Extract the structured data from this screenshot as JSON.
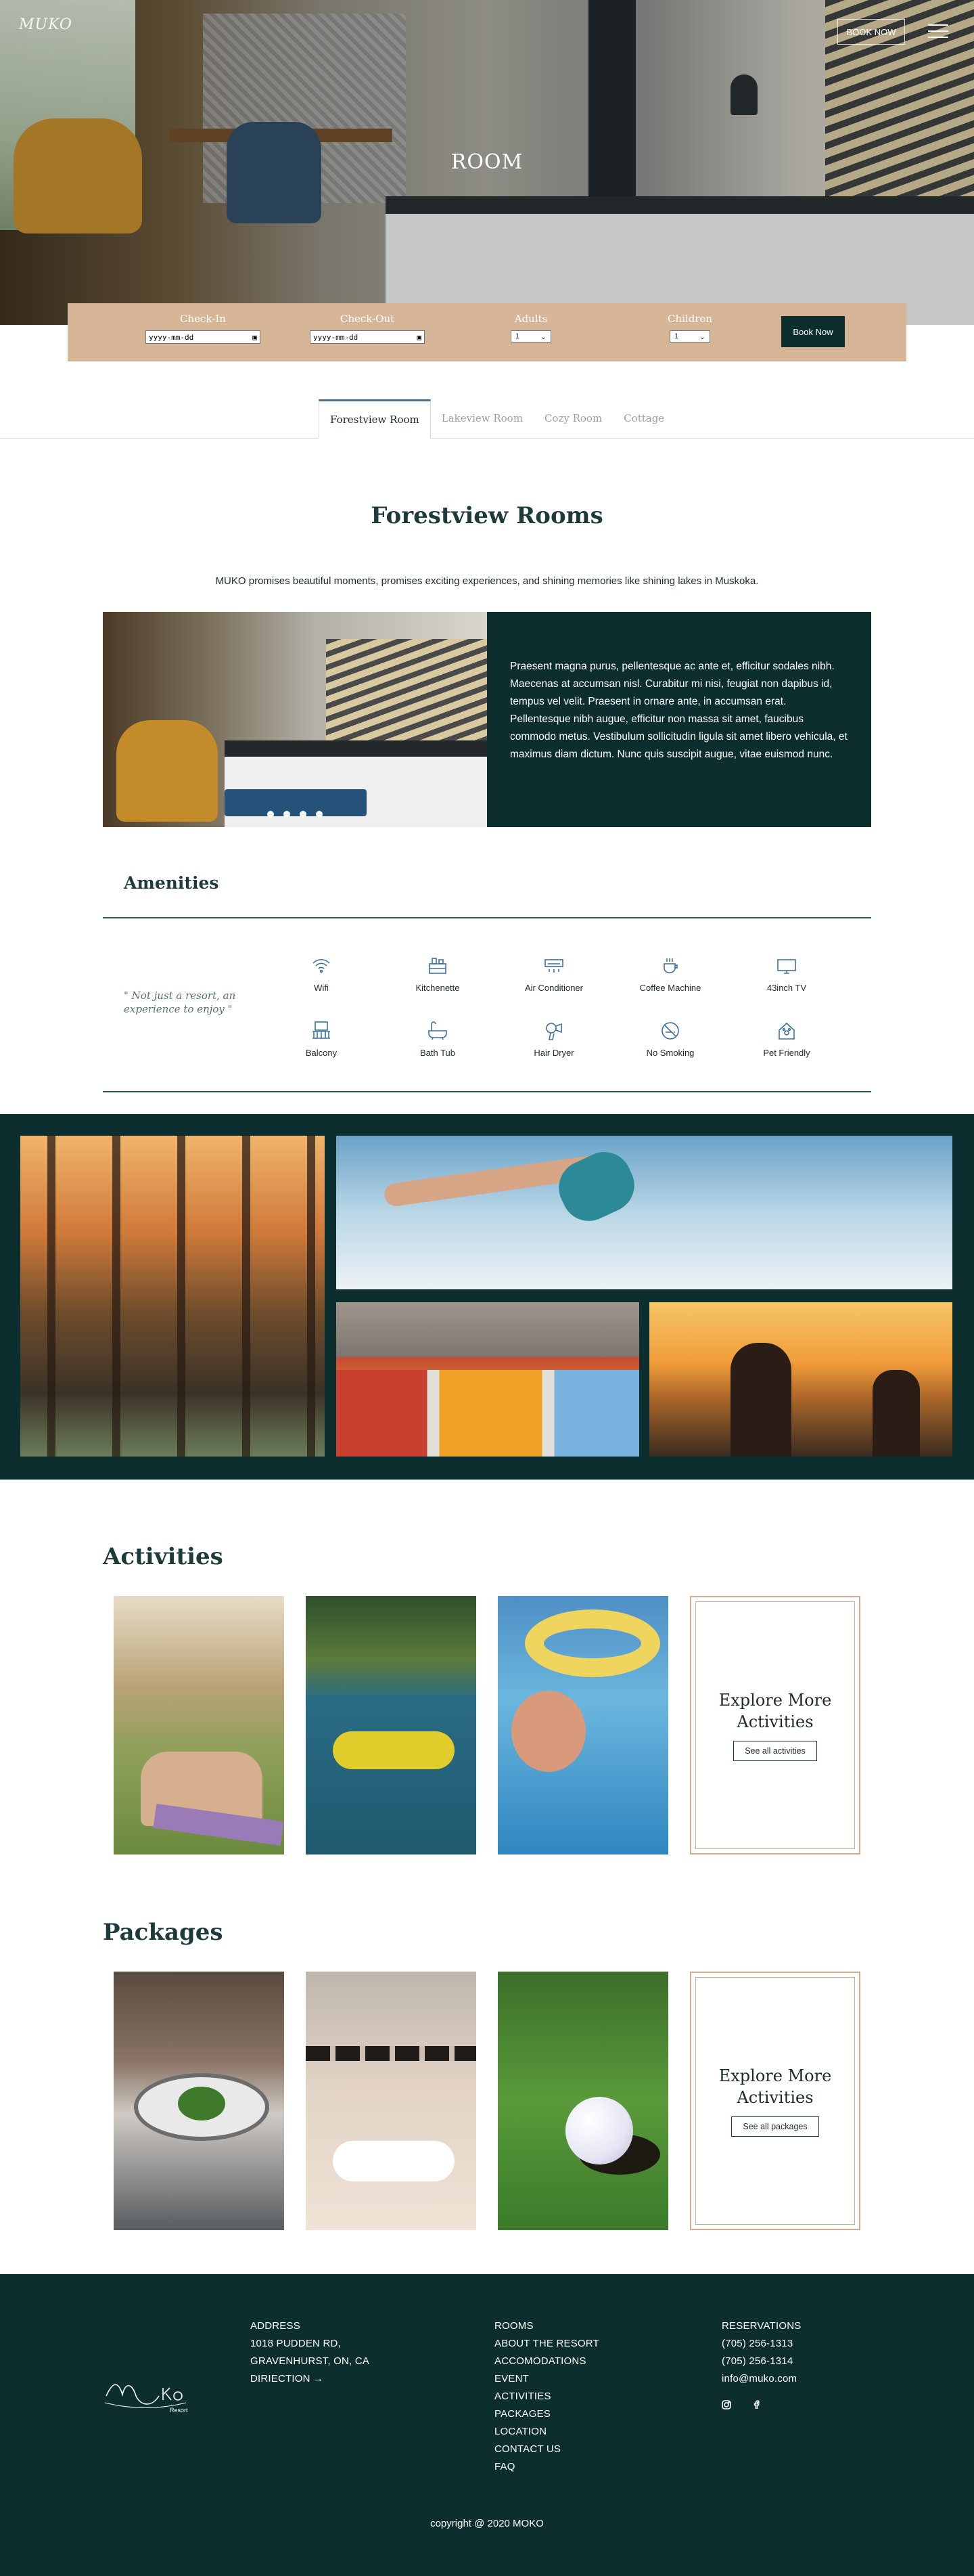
{
  "header": {
    "logo_text": "MUKO",
    "book_now_label": "BOOK NOW",
    "hero_title": "ROOM"
  },
  "booking": {
    "checkin_label": "Check-In",
    "checkin_placeholder": "yyyy-mm-dd",
    "checkout_label": "Check-Out",
    "checkout_placeholder": "yyyy-mm-dd",
    "adults_label": "Adults",
    "adults_value": "1",
    "children_label": "Children",
    "children_value": "1",
    "book_button": "Book Now"
  },
  "tabs": [
    {
      "label": "Forestview Room",
      "active": true
    },
    {
      "label": "Lakeview Room",
      "active": false
    },
    {
      "label": "Cozy Room",
      "active": false
    },
    {
      "label": "Cottage",
      "active": false
    }
  ],
  "room": {
    "title": "Forestview Rooms",
    "intro": "MUKO promises beautiful moments, promises exciting experiences, and shining memories like shining lakes in Muskoka.",
    "description": "Praesent magna purus, pellentesque ac ante et, efficitur sodales nibh. Maecenas at accumsan nisl. Curabitur mi nisi, feugiat non dapibus id, tempus vel velit. Praesent in ornare ante, in accumsan erat. Pellentesque nibh augue, efficitur non massa sit amet, faucibus commodo metus. Vestibulum sollicitudin ligula sit amet libero vehicula, et maximus diam dictum. Nunc quis suscipit augue, vitae euismod nunc.",
    "carousel_slides": 4,
    "carousel_active": 1
  },
  "amenities": {
    "title": "Amenities",
    "quote": "\" Not just a resort, an experience to enjoy \"",
    "items": [
      {
        "label": "Wifi",
        "icon": "wifi-icon"
      },
      {
        "label": "Kitchenette",
        "icon": "kitchen-icon"
      },
      {
        "label": "Air Conditioner",
        "icon": "air-conditioner-icon"
      },
      {
        "label": "Coffee Machine",
        "icon": "coffee-machine-icon"
      },
      {
        "label": "43inch TV",
        "icon": "tv-icon"
      },
      {
        "label": "Balcony",
        "icon": "balcony-icon"
      },
      {
        "label": "Bath Tub",
        "icon": "bathtub-icon"
      },
      {
        "label": "Hair Dryer",
        "icon": "hair-dryer-icon"
      },
      {
        "label": "No Smoking",
        "icon": "no-smoking-icon"
      },
      {
        "label": "Pet Friendly",
        "icon": "pet-friendly-icon"
      }
    ]
  },
  "activities": {
    "title": "Activities",
    "explore_title": "Explore More Activities",
    "explore_button": "See all activities"
  },
  "packages": {
    "title": "Packages",
    "explore_title": "Explore More Activities",
    "explore_button": "See all packages"
  },
  "footer": {
    "address_heading": "ADDRESS",
    "address_line1": "1018 PUDDEN RD,",
    "address_line2": "GRAVENHURST, ON, CA",
    "direction_label": "DIRIECTION →",
    "nav": [
      "ROOMS",
      "ABOUT THE RESORT",
      "ACCOMODATIONS",
      "EVENT",
      "ACTIVITIES",
      "PACKAGES",
      "LOCATION",
      "CONTACT US",
      "FAQ"
    ],
    "reservations_heading": "RESERVATIONS",
    "phone1": "(705) 256-1313",
    "phone2": "(705) 256-1314",
    "email": "info@muko.com",
    "logo_text": "MUKO",
    "logo_sub": "Resort",
    "copyright": "copyright @ 2020 MOKO"
  },
  "colors": {
    "primary_dark": "#0d2e2e",
    "booking_bar": "#d7b698",
    "accent_border": "#d9a98a",
    "icon_blue": "#3a6fa0"
  }
}
